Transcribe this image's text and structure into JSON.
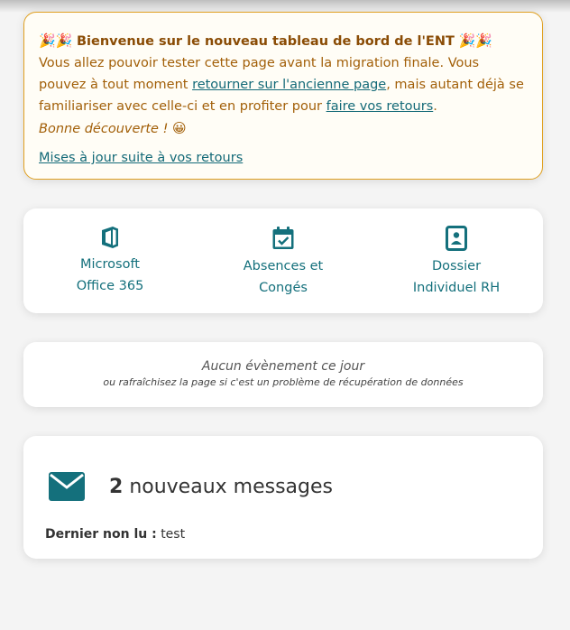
{
  "announcement": {
    "emoji": "🎉🎉",
    "title": "Bienvenue sur le nouveau tableau de bord de l'ENT",
    "text1": "Vous allez pouvoir tester cette page avant la migration finale. Vous pouvez à tout moment ",
    "link_old": "retourner sur l'ancienne page",
    "text2": ", mais autant déjà se familiariser avec celle-ci et en profiter pour ",
    "link_feedback": "faire vos retours",
    "text3": ".",
    "discover": "Bonne découverte !",
    "discover_emoji": "😀",
    "updates_link": "Mises à jour suite à vos retours"
  },
  "shortcuts": [
    {
      "icon": "office-icon",
      "line1": "Microsoft",
      "line2": "Office 365"
    },
    {
      "icon": "calendar-check-icon",
      "line1": "Absences et",
      "line2": "Congés"
    },
    {
      "icon": "id-badge-icon",
      "line1": "Dossier",
      "line2": "Individuel RH"
    }
  ],
  "events": {
    "main": "Aucun évènement ce jour",
    "sub": "ou rafraîchisez la page si c'est un problème de récupération de données"
  },
  "messages": {
    "icon": "envelope-icon",
    "count": "2",
    "label": "nouveaux messages",
    "last_unread_label": "Dernier non lu :",
    "last_unread_value": "test"
  },
  "colors": {
    "accent": "#14707c",
    "announce_border": "#e0a020",
    "announce_text": "#a25f08"
  }
}
